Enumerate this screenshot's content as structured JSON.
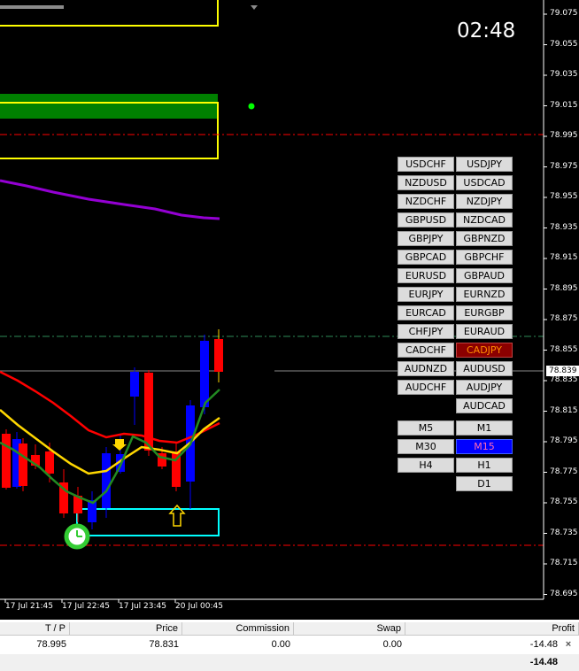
{
  "clock": "02:48",
  "price_axis": {
    "labels": [
      "79.075",
      "79.055",
      "79.035",
      "79.015",
      "78.995",
      "78.975",
      "78.955",
      "78.935",
      "78.915",
      "78.895",
      "78.875",
      "78.855",
      "78.835",
      "78.815",
      "78.795",
      "78.775",
      "78.755",
      "78.735",
      "78.715",
      "78.695"
    ],
    "current_price": "78.839"
  },
  "time_axis": {
    "labels": [
      "17 Jul 21:45",
      "17 Jul 22:45",
      "17 Jul 23:45",
      "20 Jul 00:45"
    ]
  },
  "symbol_buttons": [
    [
      "USDCHF",
      "USDJPY"
    ],
    [
      "NZDUSD",
      "USDCAD"
    ],
    [
      "NZDCHF",
      "NZDJPY"
    ],
    [
      "GBPUSD",
      "NZDCAD"
    ],
    [
      "GBPJPY",
      "GBPNZD"
    ],
    [
      "GBPCAD",
      "GBPCHF"
    ],
    [
      "EURUSD",
      "GBPAUD"
    ],
    [
      "EURJPY",
      "EURNZD"
    ],
    [
      "EURCAD",
      "EURGBP"
    ],
    [
      "CHFJPY",
      "EURAUD"
    ],
    [
      "CADCHF",
      "CADJPY"
    ],
    [
      "AUDNZD",
      "AUDUSD"
    ],
    [
      "AUDCHF",
      "AUDJPY"
    ],
    [
      "",
      "AUDCAD"
    ]
  ],
  "selected_symbol": "CADJPY",
  "timeframe_buttons": [
    [
      "M5",
      "M1"
    ],
    [
      "M30",
      "M15"
    ],
    [
      "H4",
      "H1"
    ],
    [
      "",
      "D1"
    ]
  ],
  "selected_timeframe": "M15",
  "colors": {
    "bull_candle": "#0000ff",
    "bear_candle": "#ff0000",
    "ma_red": "#ff0000",
    "ma_yellow": "#ffd700",
    "ma_green": "#228b22",
    "ma_purple": "#9400d3",
    "zone_outline": "#ffff00",
    "zone_fill": "#008000",
    "demand_box": "#00ffff",
    "level_line": "#ff0000"
  },
  "terminal": {
    "headers": [
      "T / P",
      "Price",
      "Commission",
      "Swap",
      "Profit"
    ],
    "row": [
      "78.995",
      "78.831",
      "0.00",
      "0.00",
      "-14.48"
    ],
    "total_profit": "-14.48",
    "close_icon": "close-icon"
  }
}
